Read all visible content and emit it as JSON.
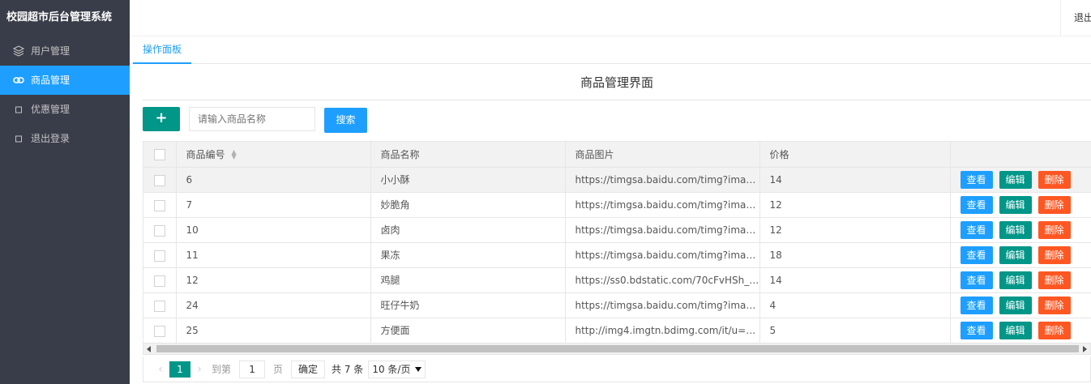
{
  "app": {
    "title": "校园超市后台管理系统",
    "logout_top": "退出"
  },
  "sidebar": {
    "items": [
      {
        "label": "用户管理",
        "icon": "layers-icon",
        "active": false
      },
      {
        "label": "商品管理",
        "icon": "link-icon",
        "active": true
      },
      {
        "label": "优惠管理",
        "icon": "square-icon",
        "active": false
      },
      {
        "label": "退出登录",
        "icon": "square-icon",
        "active": false
      }
    ]
  },
  "tabs": [
    {
      "label": "操作面板"
    }
  ],
  "main": {
    "title": "商品管理界面",
    "add_label": "+",
    "search": {
      "placeholder": "请输入商品名称",
      "value": "",
      "button": "搜索"
    }
  },
  "table": {
    "columns": [
      "商品编号",
      "商品名称",
      "商品图片",
      "价格"
    ],
    "actions": {
      "view": "查看",
      "edit": "编辑",
      "delete": "删除"
    },
    "rows": [
      {
        "id": "6",
        "name": "小小酥",
        "image": "https://timgsa.baidu.com/timg?image…",
        "price": "14"
      },
      {
        "id": "7",
        "name": "妙脆角",
        "image": "https://timgsa.baidu.com/timg?image…",
        "price": "12"
      },
      {
        "id": "10",
        "name": "卤肉",
        "image": "https://timgsa.baidu.com/timg?image…",
        "price": "12"
      },
      {
        "id": "11",
        "name": "果冻",
        "image": "https://timgsa.baidu.com/timg?image…",
        "price": "18"
      },
      {
        "id": "12",
        "name": "鸡腿",
        "image": "https://ss0.bdstatic.com/70cFvHSh_Q…",
        "price": "14"
      },
      {
        "id": "24",
        "name": "旺仔牛奶",
        "image": "https://timgsa.baidu.com/timg?image…",
        "price": "4"
      },
      {
        "id": "25",
        "name": "方便面",
        "image": "http://img4.imgtn.bdimg.com/it/u=799…",
        "price": "5"
      }
    ]
  },
  "pager": {
    "current": "1",
    "goto_prefix": "到第",
    "goto_value": "1",
    "goto_suffix": "页",
    "confirm": "确定",
    "total": "共 7 条",
    "page_size": "10 条/页"
  },
  "colors": {
    "sidebar_bg": "#393d49",
    "active_blue": "#1e9fff",
    "teal": "#009688",
    "orange": "#ff5722"
  }
}
